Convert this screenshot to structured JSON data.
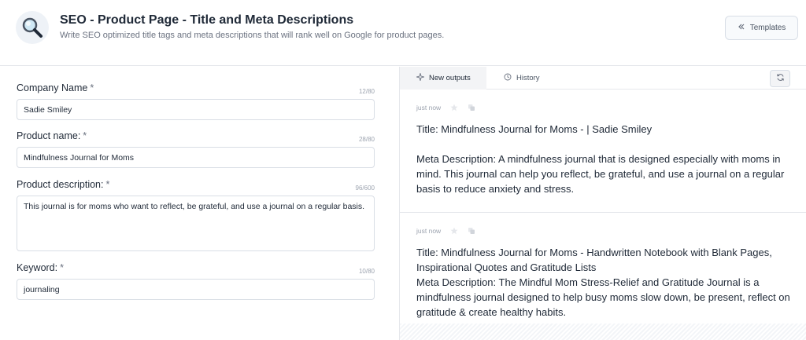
{
  "header": {
    "icon": "magnifier-icon",
    "title": "SEO - Product Page - Title and Meta Descriptions",
    "subtitle": "Write SEO optimized title tags and meta descriptions that will rank well on Google for product pages.",
    "templates_label": "Templates"
  },
  "form": {
    "company": {
      "label": "Company Name",
      "required": "*",
      "counter": "12/80",
      "value": "Sadie Smiley"
    },
    "product_name": {
      "label": "Product name:",
      "required": "*",
      "counter": "28/80",
      "value": "Mindfulness Journal for Moms"
    },
    "product_description": {
      "label": "Product description:",
      "required": "*",
      "counter": "96/600",
      "value": "This journal is for moms who want to reflect, be grateful, and use a journal on a regular basis."
    },
    "keyword": {
      "label": "Keyword:",
      "required": "*",
      "counter": "10/80",
      "value": "journaling"
    }
  },
  "tabs": {
    "new_outputs": "New outputs",
    "history": "History"
  },
  "outputs": [
    {
      "timestamp": "just now",
      "text": "Title: Mindfulness Journal for Moms - | Sadie Smiley\n\nMeta Description: A mindfulness journal that is designed especially with moms in mind. This journal can help you reflect, be grateful, and use a journal on a regular basis to reduce anxiety and stress."
    },
    {
      "timestamp": "just now",
      "text": "Title: Mindfulness Journal for Moms - Handwritten Notebook with Blank Pages, Inspirational Quotes and Gratitude Lists\nMeta Description: The Mindful Mom Stress-Relief and Gratitude Journal is a mindfulness journal designed to help busy moms slow down, be present, reflect on gratitude & create healthy habits."
    }
  ],
  "colors": {
    "accent": "#1f2937",
    "border": "#e5e7eb",
    "muted": "#9ca3af"
  }
}
